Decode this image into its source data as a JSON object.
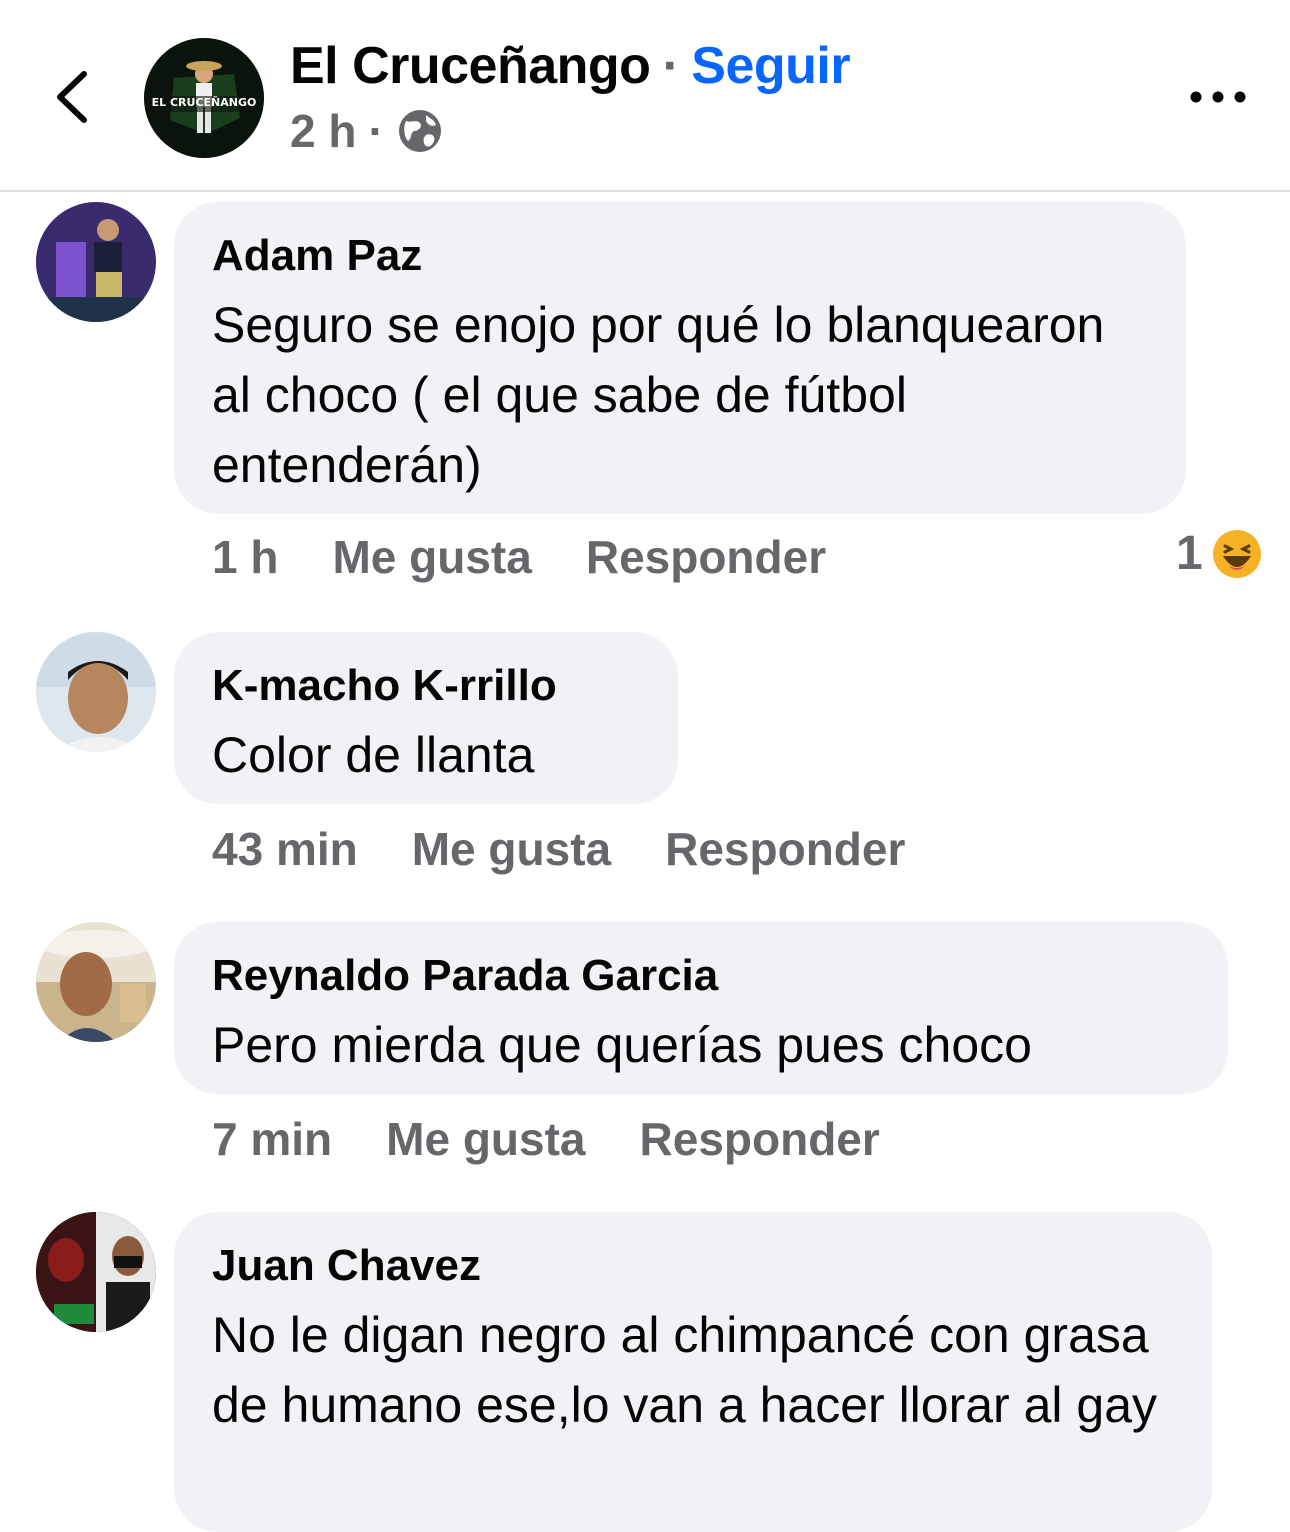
{
  "header": {
    "page_name": "El Cruceñango",
    "separator": "·",
    "follow_label": "Seguir",
    "time": "2 h",
    "dot": "·",
    "logo_text": "EL CRUCEÑANGO"
  },
  "comments": [
    {
      "author": "Adam Paz",
      "text": "Seguro se enojo por qué lo blanquearon al choco ( el que sabe de fútbol entenderán)",
      "time": "1 h",
      "like_label": "Me gusta",
      "reply_label": "Responder",
      "reaction_count": "1"
    },
    {
      "author": "K-macho K-rrillo",
      "text": "Color de llanta",
      "time": "43 min",
      "like_label": "Me gusta",
      "reply_label": "Responder"
    },
    {
      "author": "Reynaldo Parada Garcia",
      "text": "Pero mierda que querías pues choco",
      "time": "7 min",
      "like_label": "Me gusta",
      "reply_label": "Responder"
    },
    {
      "author": "Juan Chavez",
      "text": "No le digan negro al chimpancé con grasa de humano ese,lo van a hacer llorar al gay"
    }
  ],
  "colors": {
    "accent": "#0866ff",
    "secondary_text": "#65676b",
    "bubble": "#f0f2f5"
  },
  "icons": [
    "back-chevron-icon",
    "globe-icon",
    "more-options-icon",
    "haha-reaction-icon"
  ]
}
